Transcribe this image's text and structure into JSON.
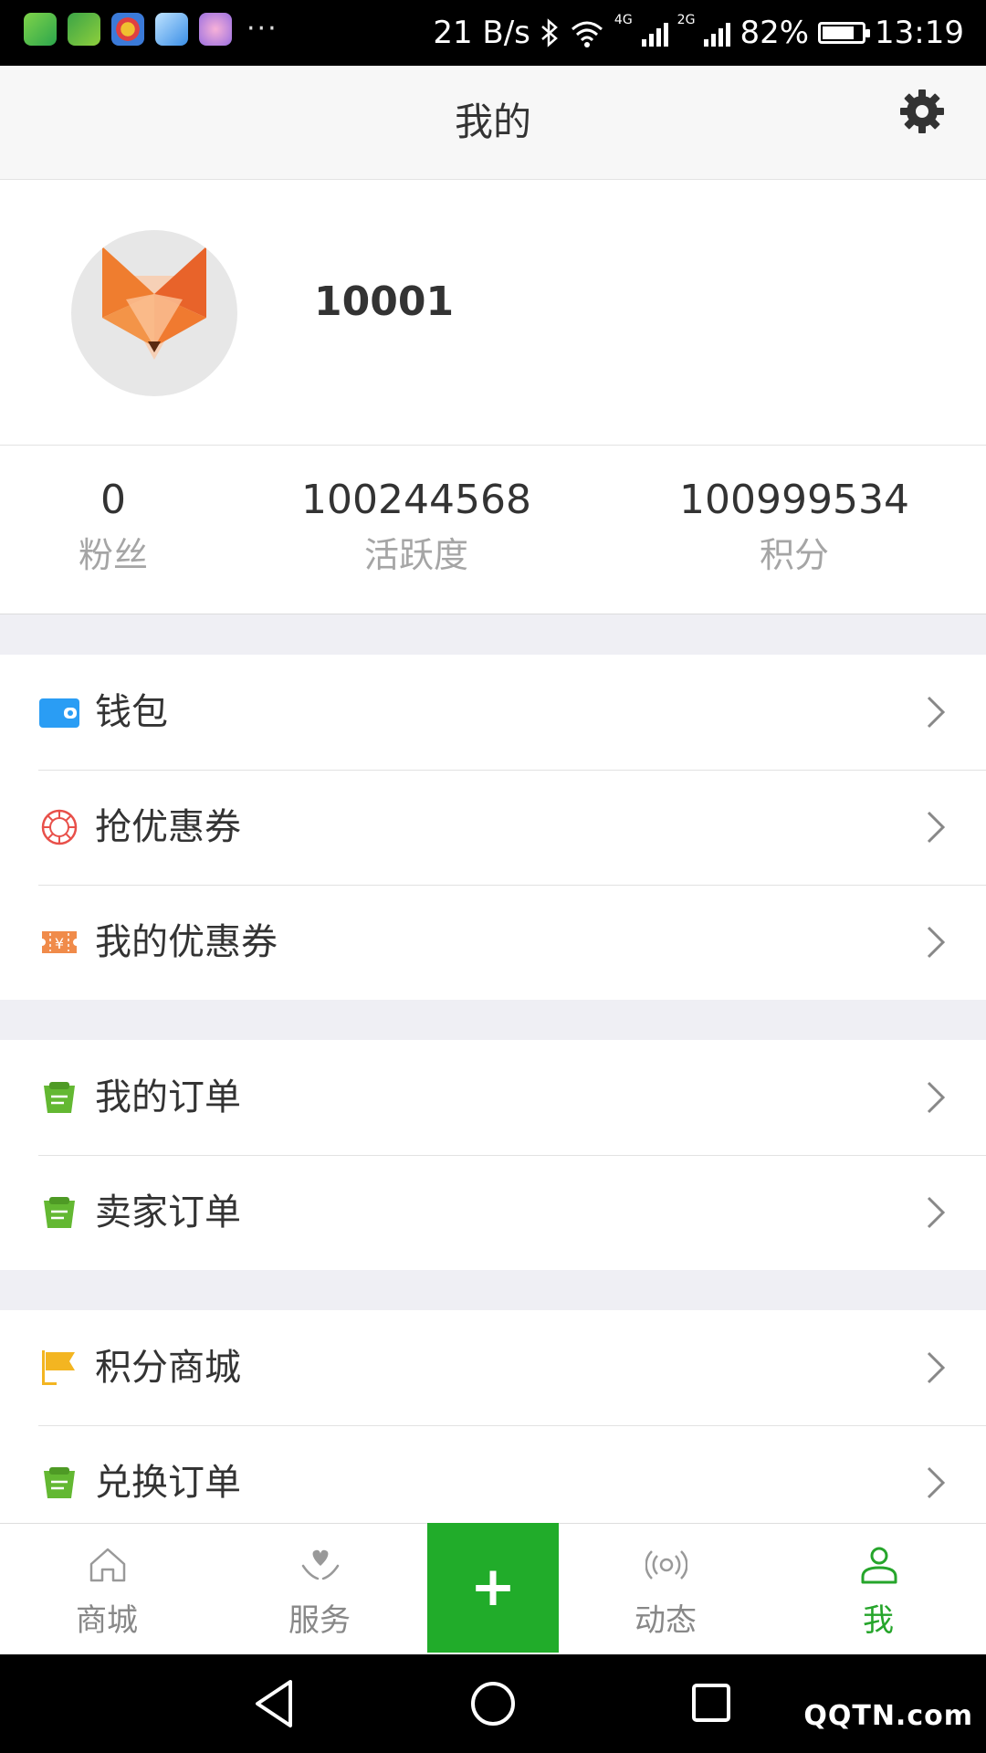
{
  "status_bar": {
    "net_speed": "21 B/s",
    "net1": "4G",
    "net2": "2G",
    "battery_percent": "82%",
    "battery_level": 0.82,
    "time": "13:19"
  },
  "header": {
    "title": "我的"
  },
  "profile": {
    "username": "10001"
  },
  "stats": [
    {
      "value": "0",
      "label": "粉丝"
    },
    {
      "value": "100244568",
      "label": "活跃度"
    },
    {
      "value": "100999534",
      "label": "积分"
    }
  ],
  "menu_groups": [
    {
      "items": [
        {
          "label": "钱包",
          "icon": "wallet-icon"
        },
        {
          "label": "抢优惠券",
          "icon": "coupon-grab-icon"
        },
        {
          "label": "我的优惠券",
          "icon": "coupon-ticket-icon"
        }
      ]
    },
    {
      "items": [
        {
          "label": "我的订单",
          "icon": "order-icon"
        },
        {
          "label": "卖家订单",
          "icon": "order-icon"
        }
      ]
    },
    {
      "items": [
        {
          "label": "积分商城",
          "icon": "flag-icon"
        },
        {
          "label": "兑换订单",
          "icon": "order-icon"
        }
      ]
    }
  ],
  "tabs": [
    {
      "label": "商城",
      "icon": "home-icon"
    },
    {
      "label": "服务",
      "icon": "heart-hands-icon"
    },
    {
      "label": "动态",
      "icon": "broadcast-icon"
    },
    {
      "label": "我",
      "icon": "person-icon",
      "active": true
    }
  ],
  "center_button": "+",
  "watermark": "QQTN.com",
  "colors": {
    "accent_green": "#21ac2a",
    "wallet_blue": "#2a9df4",
    "coupon_red": "#e8504a",
    "coupon_orange": "#f08b4a",
    "order_green": "#63b832",
    "flag_yellow": "#f3b521"
  }
}
